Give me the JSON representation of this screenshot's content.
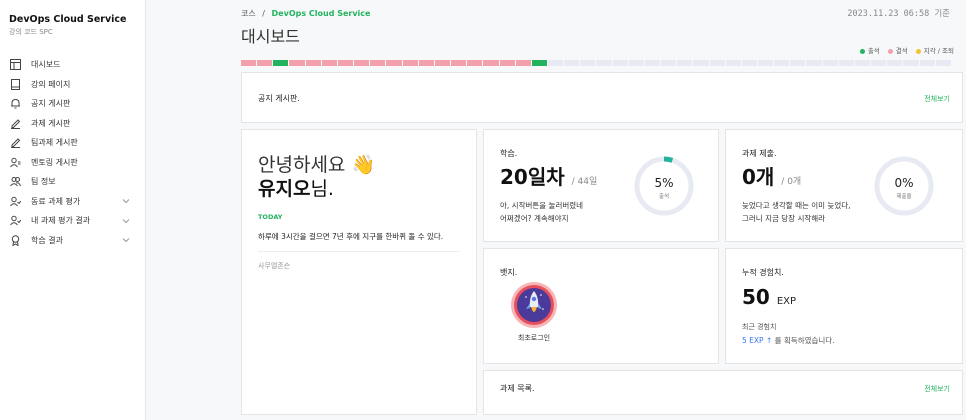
{
  "sidebar": {
    "brand": "DevOps Cloud Service",
    "subtitle": "강의 코드 SPC",
    "items": [
      {
        "label": "대시보드",
        "icon": "dashboard-icon",
        "chevron": false
      },
      {
        "label": "강의 페이지",
        "icon": "book-icon",
        "chevron": false
      },
      {
        "label": "공지 게시판",
        "icon": "bell-icon",
        "chevron": false
      },
      {
        "label": "과제 게시판",
        "icon": "pencil-icon",
        "chevron": false
      },
      {
        "label": "팀과제 게시판",
        "icon": "pencil-icon",
        "chevron": false
      },
      {
        "label": "멘토링 게시판",
        "icon": "mentor-icon",
        "chevron": false
      },
      {
        "label": "팀 정보",
        "icon": "team-icon",
        "chevron": false
      },
      {
        "label": "동료 과제 평가",
        "icon": "review-icon",
        "chevron": true
      },
      {
        "label": "내 과제 평가 결과",
        "icon": "review-icon",
        "chevron": true
      },
      {
        "label": "학습 결과",
        "icon": "medal-icon",
        "chevron": true
      }
    ]
  },
  "header": {
    "crumb_root": "코스",
    "crumb_sep": "/",
    "crumb_current": "DevOps Cloud Service",
    "timestamp": "2023.11.23 06:58 기준",
    "title": "대시보드"
  },
  "legend": {
    "present": "출석",
    "absent": "결석",
    "late": "지각 / 조퇴"
  },
  "colors": {
    "present": "#21b35e",
    "absent": "#f2a0aa",
    "late": "#f2c230",
    "empty": "#e7eaf2",
    "accent": "#21b35e"
  },
  "attendance": [
    "absent",
    "absent",
    "present",
    "absent",
    "absent",
    "absent",
    "absent",
    "absent",
    "absent",
    "absent",
    "absent",
    "absent",
    "absent",
    "absent",
    "absent",
    "absent",
    "absent",
    "absent",
    "present",
    "empty",
    "empty",
    "empty",
    "empty",
    "empty",
    "empty",
    "empty",
    "empty",
    "empty",
    "empty",
    "empty",
    "empty",
    "empty",
    "empty",
    "empty",
    "empty",
    "empty",
    "empty",
    "empty",
    "empty",
    "empty",
    "empty",
    "empty",
    "empty",
    "empty"
  ],
  "notice": {
    "title": "공지 게시판.",
    "link": "전체보기"
  },
  "welcome": {
    "hello": "안녕하세요",
    "emoji": "👋",
    "name": "유지오",
    "name_suffix": "님.",
    "today_tag": "TODAY",
    "today_text": "하루에 3시간을 걸으면 7년 후에 지구를 한바퀴 돌 수 있다.",
    "author": "사무엘존슨"
  },
  "study": {
    "title": "학습.",
    "day": "20일차",
    "total": "/ 44일",
    "msg1": "아, 시작버튼을 눌러버렸네",
    "msg2": "어쩌겠어? 계속해야지",
    "percent": "5%",
    "ring_label": "출석",
    "ring_fraction": 0.05
  },
  "assignment": {
    "title": "과제 제출.",
    "count": "0개",
    "total": "/ 0개",
    "msg1": "늦었다고 생각할 때는 이미 늦었다,",
    "msg2": "그러니 지금 당장 시작해라",
    "percent": "0%",
    "ring_label": "제출율",
    "ring_fraction": 0
  },
  "badge": {
    "title": "뱃지.",
    "name": "최초로그인"
  },
  "exp": {
    "title": "누적 경험치.",
    "value": "50",
    "unit": "EXP",
    "recent_label": "최근 경험치",
    "recent_gain": "5 EXP ↑",
    "recent_suffix": " 를 획득하였습니다."
  },
  "tasks": {
    "title": "과제 목록.",
    "link": "전체보기"
  }
}
